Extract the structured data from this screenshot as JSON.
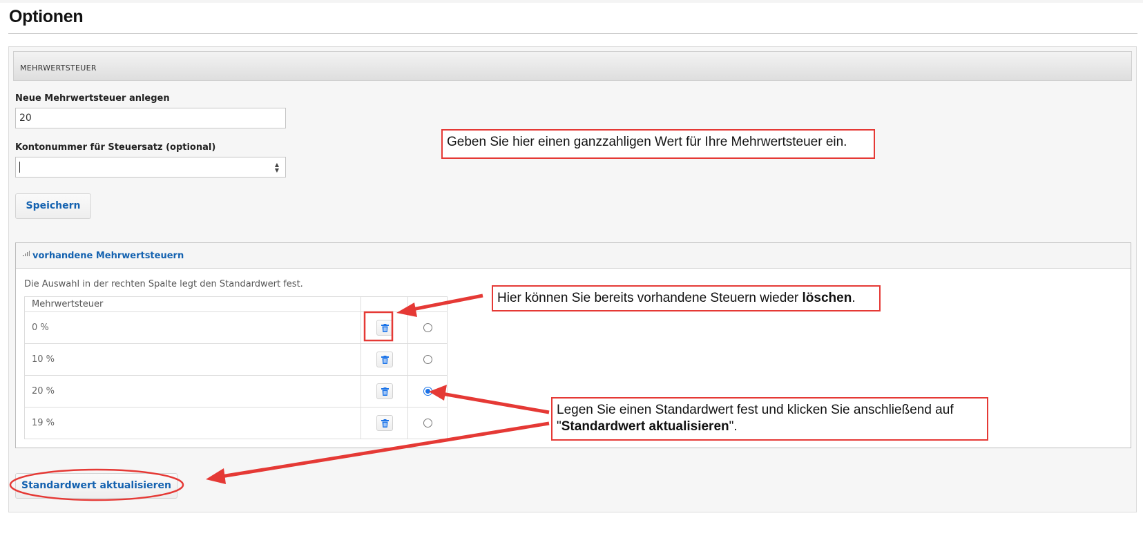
{
  "page": {
    "title": "Optionen"
  },
  "panel": {
    "header": "MEHRWERTSTEUER",
    "new_vat_label": "Neue Mehrwertsteuer anlegen",
    "new_vat_value": "20",
    "account_label": "Kontonummer für Steuersatz (optional)",
    "account_value": "",
    "save_label": "Speichern"
  },
  "existing": {
    "title": "vorhandene Mehrwertsteuern",
    "help": "Die Auswahl in der rechten Spalte legt den Standardwert fest.",
    "column_header": "Mehrwertsteuer",
    "rows": [
      {
        "rate": "0 %",
        "default": false
      },
      {
        "rate": "10 %",
        "default": false
      },
      {
        "rate": "20 %",
        "default": true
      },
      {
        "rate": "19 %",
        "default": false
      }
    ]
  },
  "update_button": "Standardwert aktualisieren",
  "callouts": {
    "integer_hint": "Geben Sie hier einen ganzzahligen Wert für Ihre Mehrwertsteuer ein.",
    "delete_hint_pre": "Hier können Sie bereits vorhandene Steuern wieder ",
    "delete_hint_bold": "löschen",
    "delete_hint_post": ".",
    "default_hint_line1": "Legen Sie einen Standardwert fest und klicken Sie anschließend auf",
    "default_hint_pre": "\"",
    "default_hint_bold": "Standardwert aktualisieren",
    "default_hint_post": "\"."
  },
  "colors": {
    "accent": "#1462b0",
    "annotation": "#e53935",
    "radio": "#1a73e8"
  },
  "icons": [
    "bars-icon",
    "trash-icon",
    "updown-arrows-icon"
  ]
}
